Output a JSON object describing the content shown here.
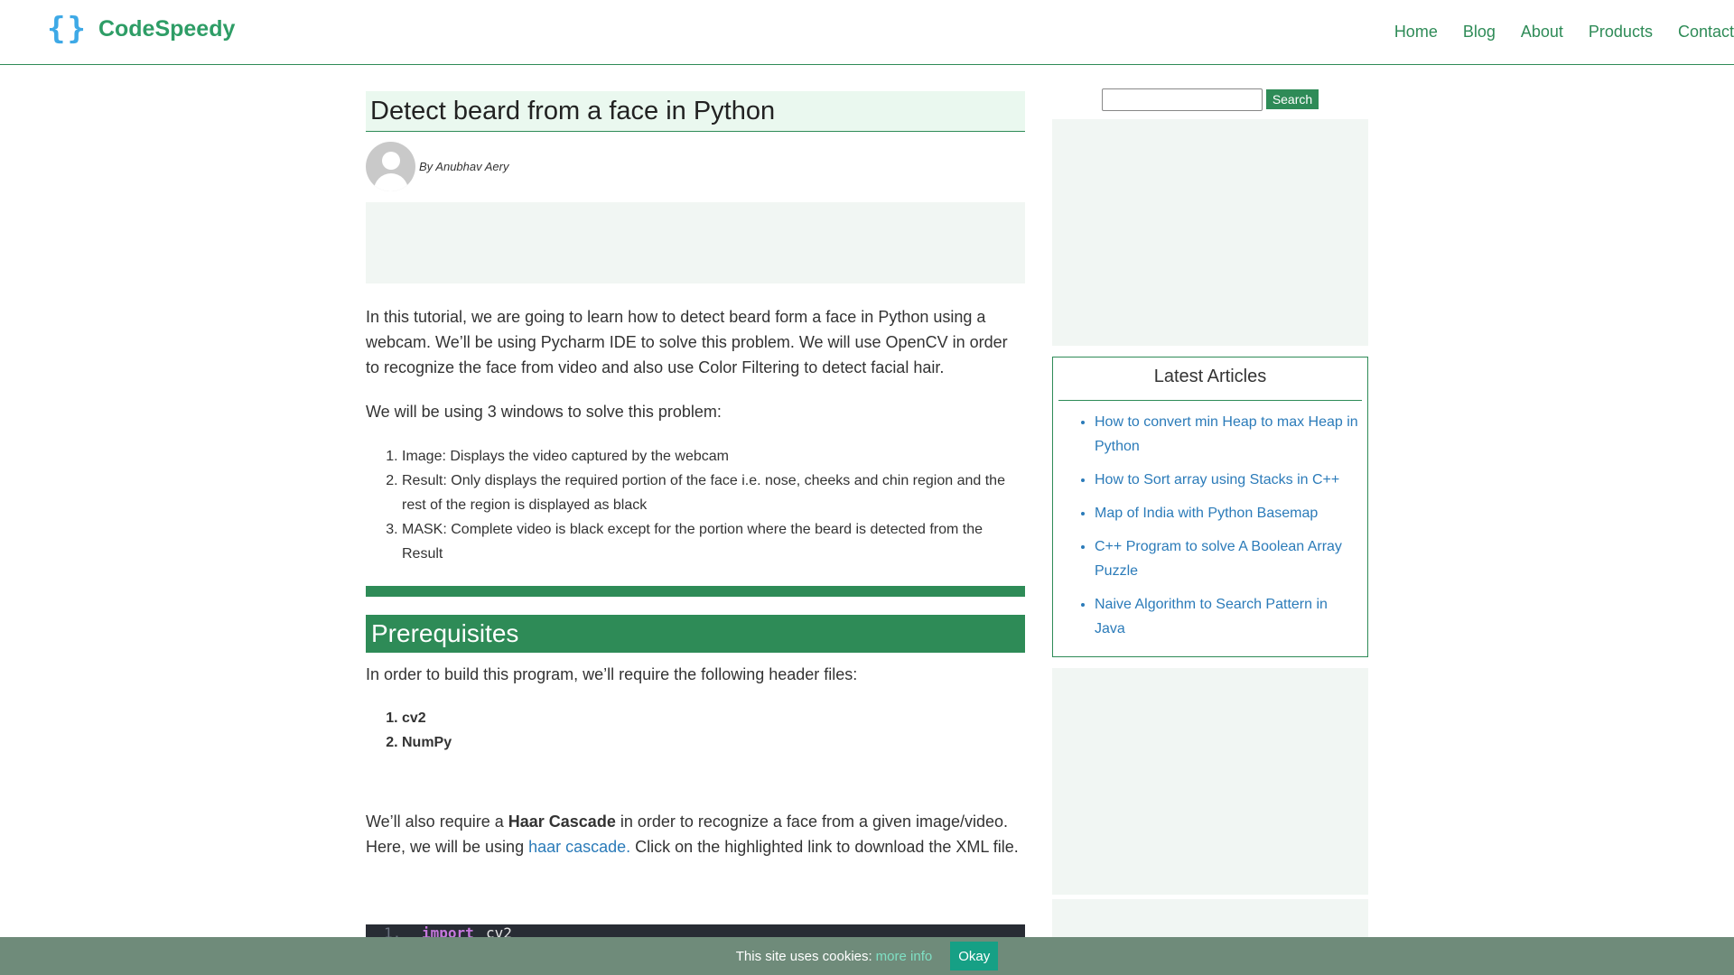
{
  "header": {
    "logo_icon": "{}",
    "logo_text": "CodeSpeedy",
    "nav": [
      "Home",
      "Blog",
      "About",
      "Products",
      "Contact"
    ]
  },
  "post": {
    "title": "Detect beard from a face in Python",
    "author": "By Anubhav Aery",
    "intro": "In this tutorial, we are going to learn how to detect beard form a face in Python using a webcam. We’ll be using Pycharm IDE to solve this problem. We will use OpenCV in order to recognize the face from video and also use Color Filtering to detect facial hair.",
    "windows_intro": "We will be using 3 windows to solve this problem:",
    "windows": [
      "Image: Displays the video captured by the webcam",
      "Result: Only displays the required portion of the face i.e.  nose, cheeks and chin region and the rest of the region is displayed as black",
      "MASK: Complete video is black except for the portion where the beard is detected from the Result"
    ],
    "prereq_heading": "Prerequisites",
    "prereq_intro": "In order to build this program, we’ll require the following header files:",
    "headers": [
      "cv2",
      "NumPy"
    ],
    "haar_pre": "We’ll also require a ",
    "haar_bold": "Haar Cascade",
    "haar_mid": " in order to recognize a face from a given image/video. Here, we will be using ",
    "haar_link": "haar cascade.",
    "haar_post": " Click on the highlighted link to download the XML file.",
    "code": {
      "line_no": "1.",
      "keyword": "import",
      "module": "cv2"
    }
  },
  "sidebar": {
    "search_button": "Search",
    "search_value": "",
    "latest_title": "Latest Articles",
    "articles": [
      "How to convert min Heap to max Heap in Python",
      "How to Sort array using Stacks in C++",
      "Map of India with Python Basemap",
      "C++ Program to solve A Boolean Array Puzzle",
      "Naive Algorithm to Search Pattern in Java"
    ]
  },
  "cookie": {
    "text": "This site uses cookies:",
    "link": "more info",
    "button": "Okay"
  },
  "colors": {
    "brand_green": "#2e8b57",
    "logo_blue": "#3ea9e6",
    "link_blue": "#2b7bb9",
    "cookie_bg": "#6f8b7a",
    "cookie_button": "#16a085"
  }
}
